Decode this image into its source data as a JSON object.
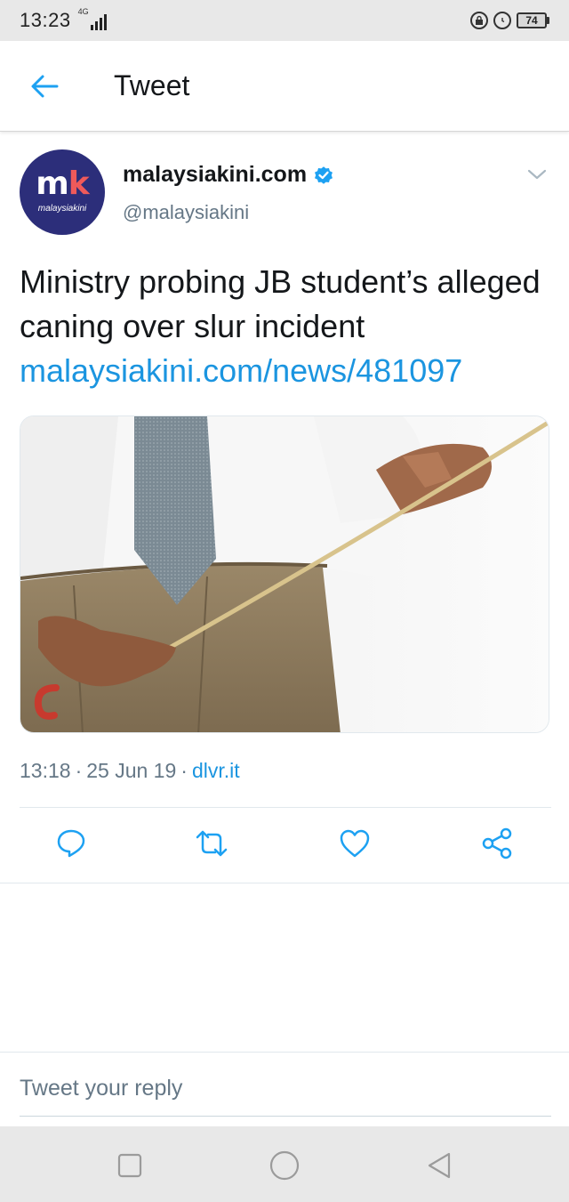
{
  "status_bar": {
    "time": "13:23",
    "network": "4G",
    "battery": "74"
  },
  "header": {
    "title": "Tweet",
    "back_icon": "arrow-left-icon"
  },
  "tweet": {
    "author": {
      "display_name": "malaysiakini.com",
      "handle": "@malaysiakini",
      "verified": true,
      "avatar_logo": "mk",
      "avatar_text": "malaysiakini"
    },
    "text": "Ministry probing JB student’s alleged caning over slur incident",
    "link": "malaysiakini.com/news/481097",
    "time": "13:18",
    "date": "25 Jun 19",
    "separator": "·",
    "source": "dlvr.it",
    "actions": [
      {
        "name": "reply",
        "icon": "reply-icon"
      },
      {
        "name": "retweet",
        "icon": "retweet-icon"
      },
      {
        "name": "like",
        "icon": "heart-icon"
      },
      {
        "name": "share",
        "icon": "share-icon"
      }
    ]
  },
  "reply": {
    "placeholder": "Tweet your reply"
  },
  "colors": {
    "accent": "#1da1f2",
    "link": "#1b95e0",
    "secondary_text": "#657786",
    "avatar_bg": "#2c2e7a"
  }
}
